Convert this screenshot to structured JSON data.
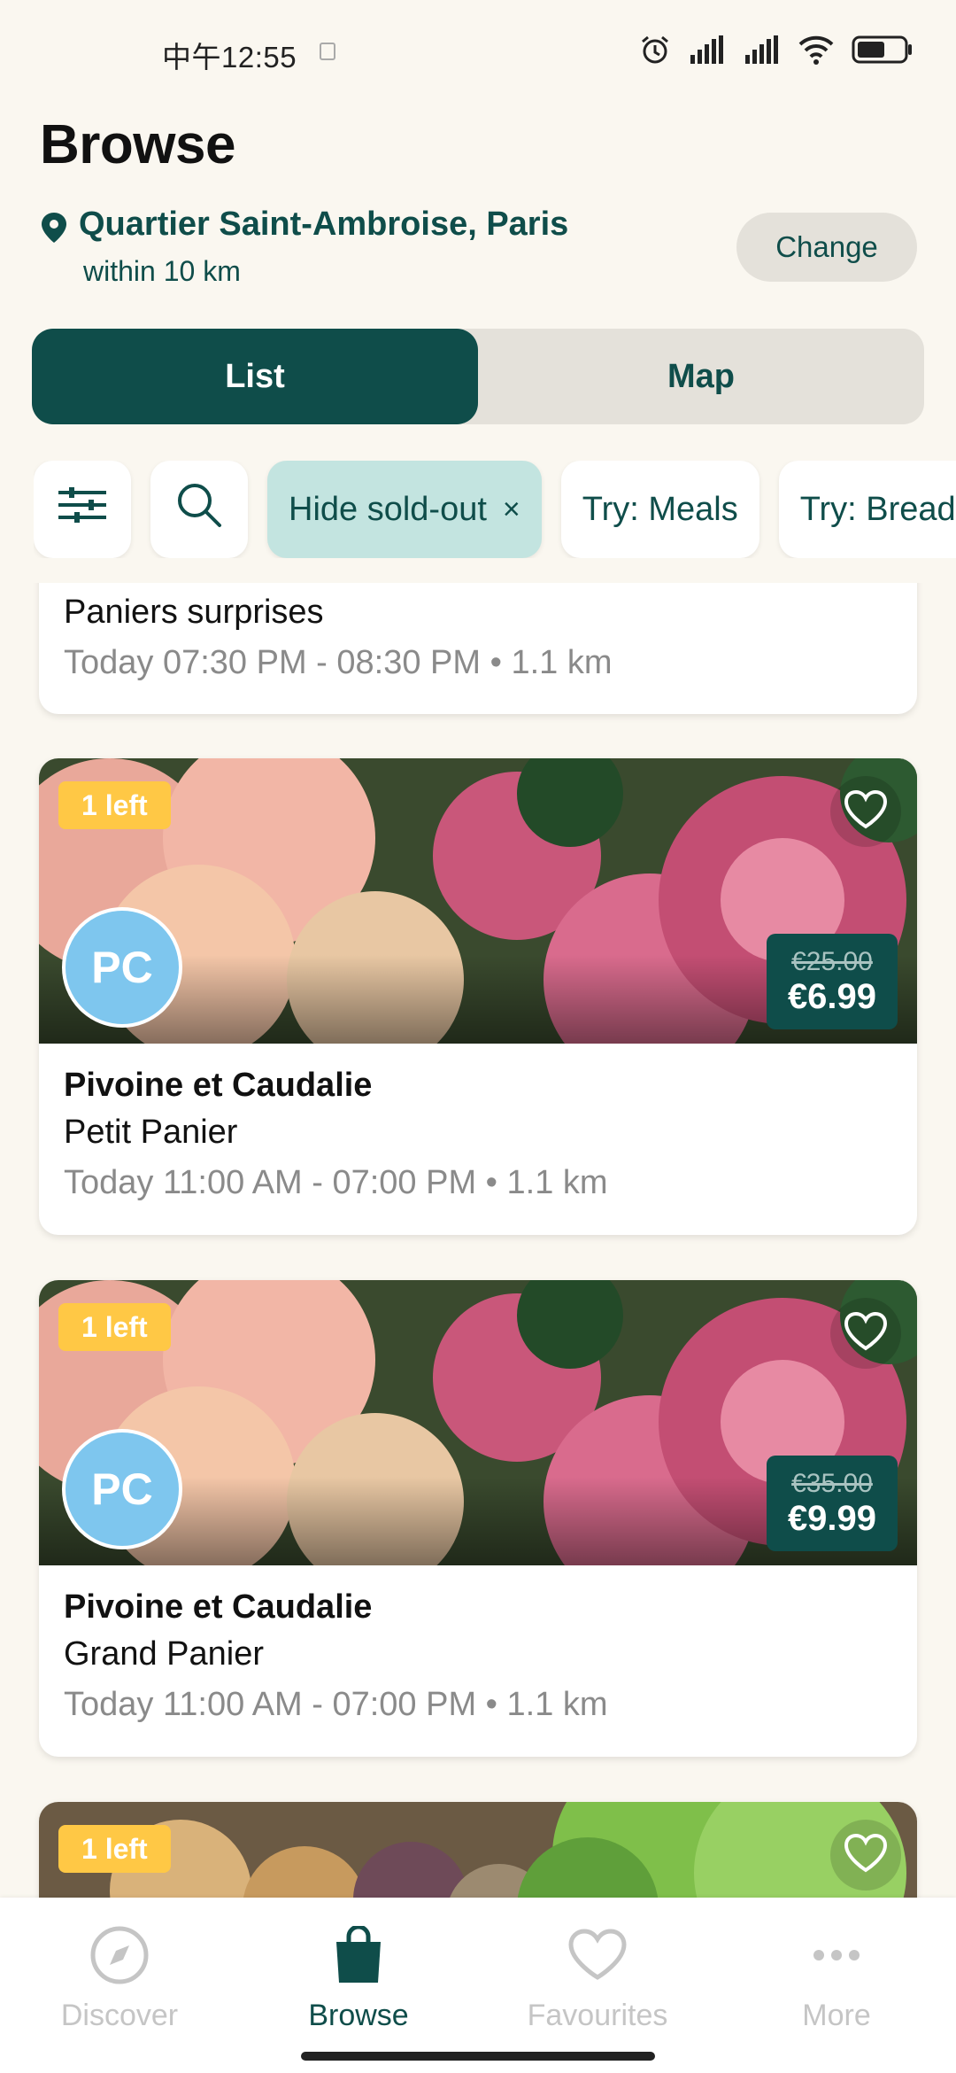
{
  "status_bar": {
    "time": "中午12:55"
  },
  "header": {
    "title": "Browse",
    "location": "Quartier Saint-Ambroise, Paris",
    "radius": "within 10 km",
    "change_label": "Change"
  },
  "view_toggle": {
    "list_label": "List",
    "map_label": "Map",
    "active": "List"
  },
  "filters": {
    "chips": [
      "Hide sold-out",
      "Try: Meals",
      "Try: Bread"
    ],
    "remove_icon": "×"
  },
  "listings": [
    {
      "item": "Paniers surprises",
      "pickup": "Today 07:30 PM - 08:30 PM • 1.1 km"
    },
    {
      "badge": "1 left",
      "logo": "PC",
      "store": "Pivoine et Caudalie",
      "item": "Petit Panier",
      "pickup": "Today 11:00 AM - 07:00 PM • 1.1 km",
      "orig_price": "€25.00",
      "price": "€6.99"
    },
    {
      "badge": "1 left",
      "logo": "PC",
      "store": "Pivoine et Caudalie",
      "item": "Grand Panier",
      "pickup": "Today 11:00 AM - 07:00 PM • 1.1 km",
      "orig_price": "€35.00",
      "price": "€9.99"
    },
    {
      "badge": "1 left"
    }
  ],
  "tabbar": {
    "items": [
      {
        "label": "Discover",
        "icon": "compass-icon"
      },
      {
        "label": "Browse",
        "icon": "bag-icon"
      },
      {
        "label": "Favourites",
        "icon": "heart-icon"
      },
      {
        "label": "More",
        "icon": "more-icon"
      }
    ],
    "active": "Browse"
  },
  "colors": {
    "brand": "#0f4d4a",
    "badge": "#ffc845",
    "logo": "#7ec6ee",
    "chip_active": "#c3e4e0"
  }
}
